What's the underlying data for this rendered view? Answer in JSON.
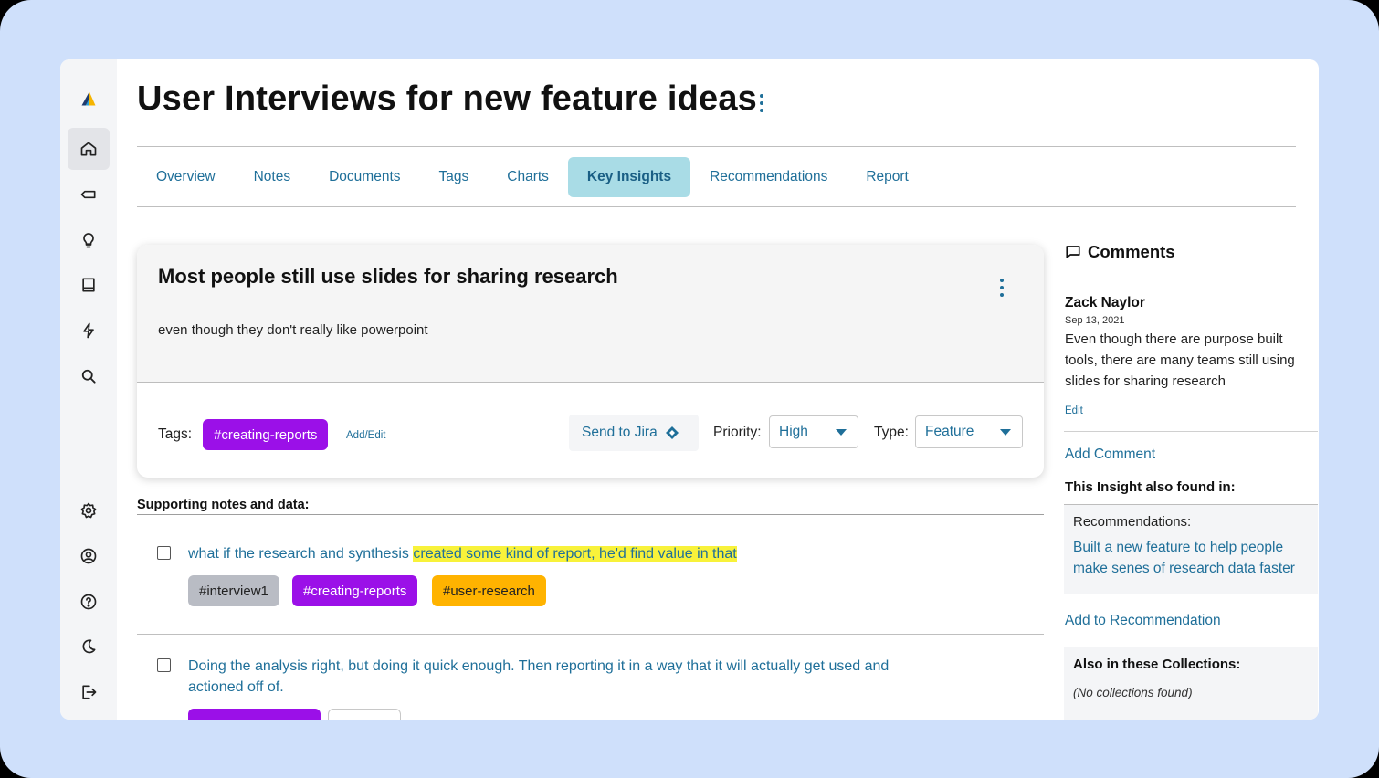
{
  "page": {
    "title": "User Interviews for new feature ideas"
  },
  "sidebar": {
    "items": [
      {
        "icon": "logo-icon"
      },
      {
        "icon": "home-icon",
        "active": true
      },
      {
        "icon": "tag-icon"
      },
      {
        "icon": "lightbulb-icon"
      },
      {
        "icon": "book-icon"
      },
      {
        "icon": "lightning-icon"
      },
      {
        "icon": "search-icon"
      },
      {
        "icon": "settings-icon"
      },
      {
        "icon": "account-icon"
      },
      {
        "icon": "help-icon"
      },
      {
        "icon": "dark-mode-icon"
      },
      {
        "icon": "logout-icon"
      }
    ]
  },
  "tabs": [
    {
      "label": "Overview"
    },
    {
      "label": "Notes"
    },
    {
      "label": "Documents"
    },
    {
      "label": "Tags"
    },
    {
      "label": "Charts"
    },
    {
      "label": "Key Insights",
      "active": true
    },
    {
      "label": "Recommendations"
    },
    {
      "label": "Report"
    }
  ],
  "insight": {
    "title": "Most people still use slides for sharing research",
    "description": "even though they don't really like powerpoint",
    "tags_label": "Tags:",
    "tags": [
      "#creating-reports"
    ],
    "add_edit": "Add/Edit",
    "send_to_jira": "Send to Jira",
    "priority_label": "Priority:",
    "priority": "High",
    "type_label": "Type:",
    "type": "Feature"
  },
  "supporting": {
    "label": "Supporting notes and data:",
    "notes": [
      {
        "text_plain": "what if the research and synthesis ",
        "text_highlight": "created some kind of report, he'd find value in that",
        "tags": [
          "#interview1",
          "#creating-reports",
          "#user-research"
        ]
      },
      {
        "text_plain": "Doing the analysis right, but doing it quick enough. Then reporting it in a way that it will actually get used and actioned off of."
      }
    ]
  },
  "comments": {
    "heading": "Comments",
    "items": [
      {
        "author": "Zack Naylor",
        "date": "Sep 13, 2021",
        "body": "Even though there are purpose built tools, there are many teams still using slides for sharing research",
        "edit": "Edit"
      }
    ],
    "add_comment": "Add Comment",
    "also_found": "This Insight also found in:",
    "recommendations_label": "Recommendations:",
    "recommendation": "Built a new feature to help people make senes of research data faster",
    "add_to_recommendation": "Add to Recommendation",
    "collections_label": "Also in these Collections:",
    "collections_empty": "(No collections found)"
  },
  "colors": {
    "accent": "#1f6f99",
    "tab_active_bg": "#a9dce6",
    "tag_purple": "#9b10e8",
    "tag_grey": "#b9bcc4",
    "tag_orange": "#ffb300",
    "highlight": "#f8f23a",
    "frame_bg": "#cfe0fb"
  }
}
